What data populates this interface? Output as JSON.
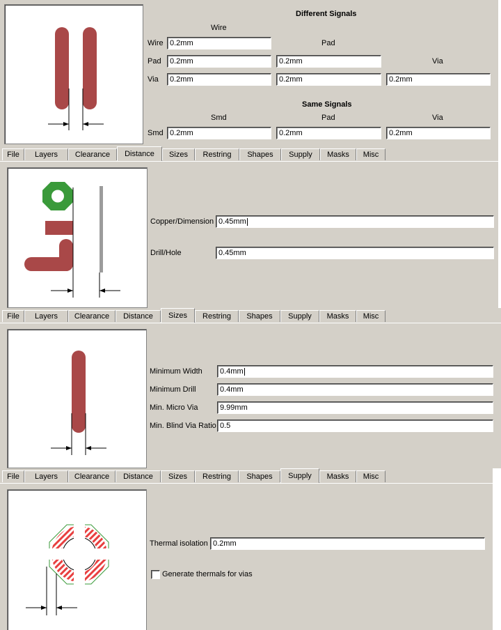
{
  "clearance": {
    "different_signals_title": "Different Signals",
    "same_signals_title": "Same Signals",
    "col_wire": "Wire",
    "col_pad": "Pad",
    "col_via": "Via",
    "row_wire": "Wire",
    "row_pad": "Pad",
    "row_via": "Via",
    "wire_wire": "0.2mm",
    "pad_wire": "0.2mm",
    "pad_pad": "0.2mm",
    "via_wire": "0.2mm",
    "via_pad": "0.2mm",
    "via_via": "0.2mm",
    "same_col_smd": "Smd",
    "same_col_pad": "Pad",
    "same_col_via": "Via",
    "row_smd": "Smd",
    "smd_smd": "0.2mm",
    "smd_pad": "0.2mm",
    "smd_via": "0.2mm"
  },
  "tabs": [
    "File",
    "Layers",
    "Clearance",
    "Distance",
    "Sizes",
    "Restring",
    "Shapes",
    "Supply",
    "Masks",
    "Misc"
  ],
  "distance": {
    "copper_label": "Copper/Dimension",
    "copper_value": "0.45mm",
    "drill_label": "Drill/Hole",
    "drill_value": "0.45mm"
  },
  "sizes": {
    "min_width_label": "Minimum Width",
    "min_width_value": "0.4mm",
    "min_drill_label": "Minimum Drill",
    "min_drill_value": "0.4mm",
    "micro_via_label": "Min. Micro Via",
    "micro_via_value": "9.99mm",
    "blind_ratio_label": "Min. Blind Via Ratio",
    "blind_ratio_value": "0.5"
  },
  "supply": {
    "thermal_label": "Thermal isolation",
    "thermal_value": "0.2mm",
    "generate_label": "Generate thermals for vias",
    "generate_checked": false
  },
  "colors": {
    "track": "#a94848",
    "pad_green": "#3a9a3a",
    "dialog_bg": "#d4d0c8"
  }
}
